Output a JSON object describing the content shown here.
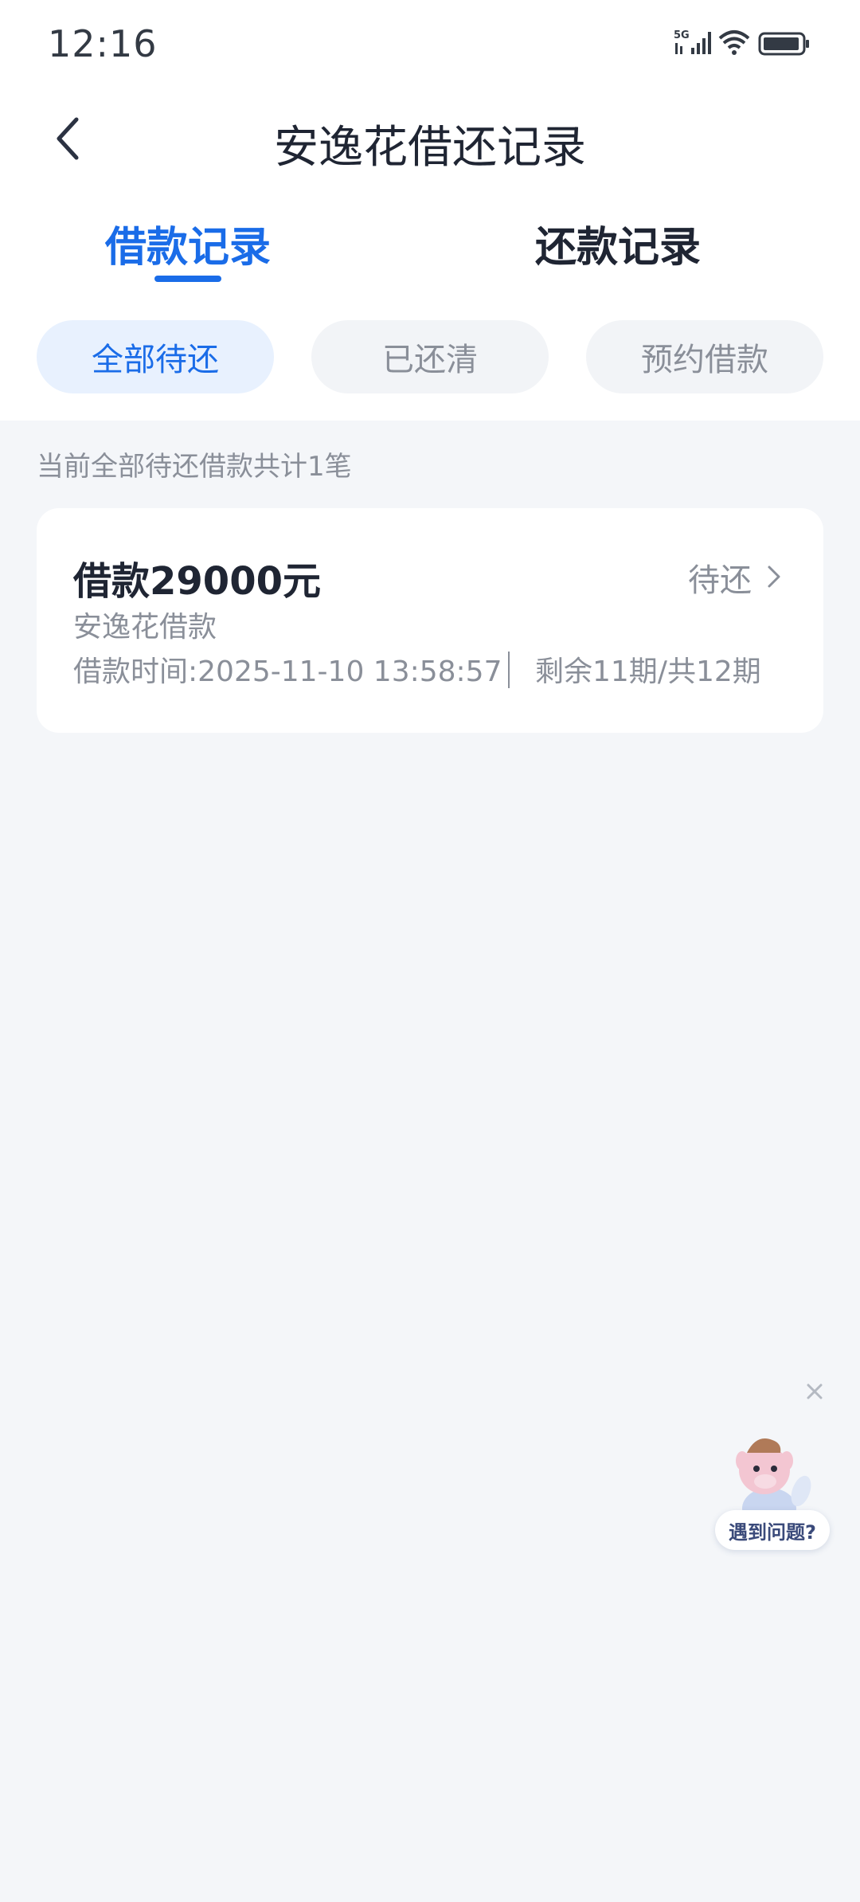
{
  "status_bar": {
    "time": "12:16"
  },
  "header": {
    "title": "安逸花借还记录"
  },
  "main_tabs": [
    {
      "label": "借款记录",
      "active": true
    },
    {
      "label": "还款记录",
      "active": false
    }
  ],
  "sub_tabs": [
    {
      "label": "全部待还",
      "active": true
    },
    {
      "label": "已还清",
      "active": false
    },
    {
      "label": "预约借款",
      "active": false
    }
  ],
  "summary": "当前全部待还借款共计1笔",
  "loans": [
    {
      "amount": "借款29000元",
      "status": "待还",
      "product": "安逸花借款",
      "time": "借款时间:2025-11-10 13:58:57",
      "periods": "剩余11期/共12期"
    }
  ],
  "help": {
    "label": "遇到问题?"
  },
  "colors": {
    "accent": "#1a6ce8",
    "background": "#f4f6f9",
    "text": "#1f2533",
    "muted": "#8a8f99"
  }
}
